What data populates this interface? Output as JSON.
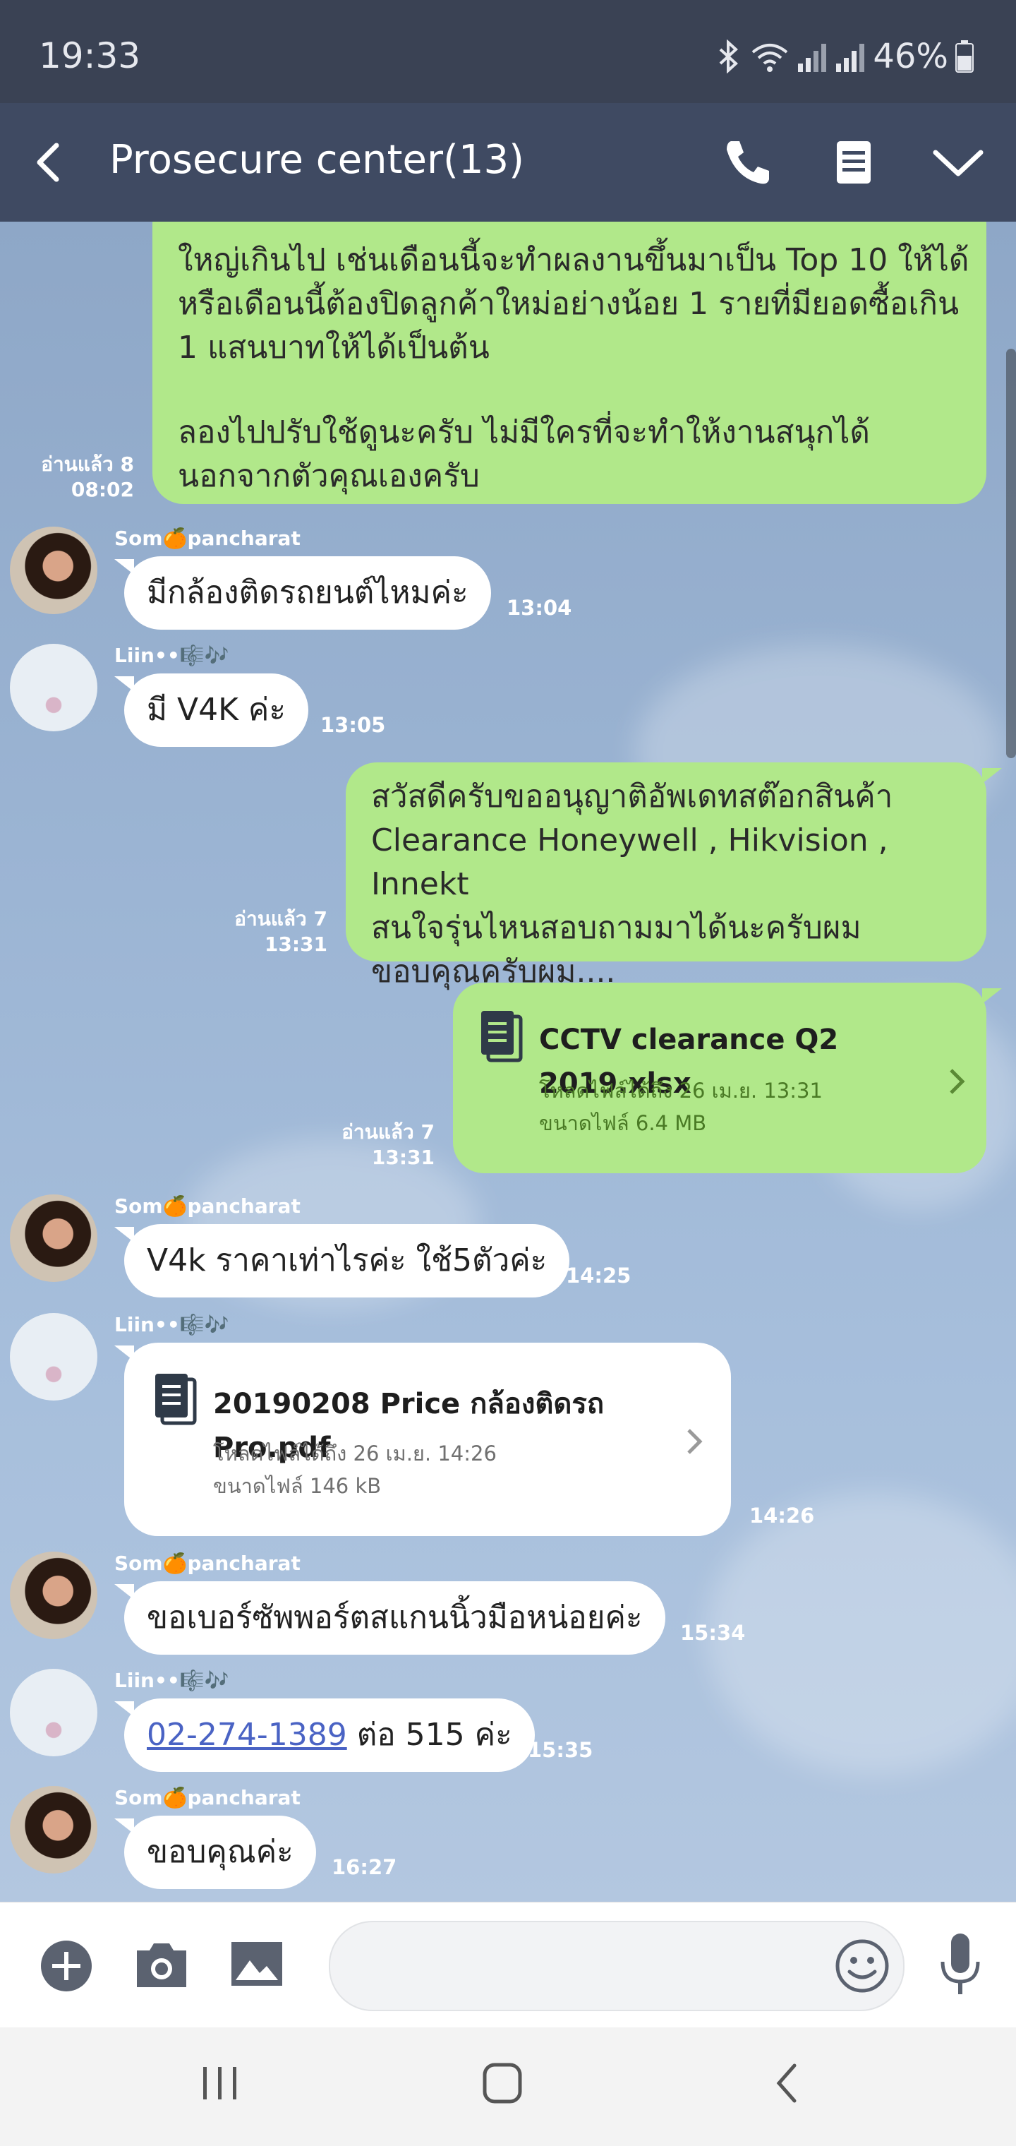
{
  "status_bar": {
    "time": "19:33",
    "battery": "46%"
  },
  "header": {
    "title": "Prosecure center(13)",
    "icons": [
      "back-icon",
      "phone-icon",
      "notes-icon",
      "chevron-down-icon"
    ]
  },
  "messages": {
    "m1": {
      "lines": [
        "ใหญ่เกินไป เช่นเดือนนี้จะทำผลงานขึ้นมาเป็น Top 10 ให้ได้",
        "หรือเดือนนี้ต้องปิดลูกค้าใหม่อย่างน้อย 1 รายที่มียอดซื้อเกิน",
        "1 แสนบาทให้ได้เป็นต้น",
        "ลองไปปรับใช้ดูนะครับ ไม่มีใครที่จะทำให้งานสนุกได้",
        "นอกจากตัวคุณเองครับ"
      ],
      "read": "อ่านแล้ว 8",
      "time": "08:02"
    },
    "m2": {
      "sender": "Som🍊pancharat",
      "text": "มีกล้องติดรถยนต์ไหมค่ะ",
      "time": "13:04"
    },
    "m3": {
      "sender": "Liin••🎼🎶",
      "text": "มี V4K ค่ะ",
      "time": "13:05"
    },
    "m4": {
      "lines": [
        "สวัสดีครับขออนุญาติอัพเดทสต๊อกสินค้า",
        "Clearance Honeywell , Hikvision , Innekt",
        "สนใจรุ่นไหนสอบถามมาได้นะครับผม",
        "ขอบคุณครับผม...."
      ],
      "read": "อ่านแล้ว 7",
      "time": "13:31"
    },
    "m5": {
      "file_name": "CCTV clearance Q2 2019.xlsx",
      "download": "โหลดไฟล์ได้ถึง 26 เม.ย. 13:31",
      "size": "ขนาดไฟล์ 6.4 MB",
      "read": "อ่านแล้ว 7",
      "time": "13:31"
    },
    "m6": {
      "sender": "Som🍊pancharat",
      "text": "V4k ราคาเท่าไรค่ะ ใช้5ตัวค่ะ",
      "time": "14:25"
    },
    "m7": {
      "sender": "Liin••🎼🎶",
      "file_name": "20190208 Price กล้องติดรถ Pro.pdf",
      "download": "โหลดไฟล์ได้ถึง 26 เม.ย. 14:26",
      "size": "ขนาดไฟล์ 146 kB",
      "time": "14:26"
    },
    "m8": {
      "sender": "Som🍊pancharat",
      "text": "ขอเบอร์ซัพพอร์ตสแกนนิ้วมือหน่อยค่ะ",
      "time": "15:34"
    },
    "m9": {
      "sender": "Liin••🎼🎶",
      "phone": "02-274-1389",
      "text": " ต่อ 515 ค่ะ",
      "time": "15:35"
    },
    "m10": {
      "sender": "Som🍊pancharat",
      "text": "ขอบคุณค่ะ",
      "time": "16:27"
    }
  },
  "input_bar": {
    "icons": [
      "plus-icon",
      "camera-icon",
      "image-icon",
      "emoji-icon",
      "microphone-icon"
    ],
    "message_value": ""
  },
  "nav_bar": {
    "icons": [
      "recent-apps-icon",
      "home-icon",
      "back-nav-icon"
    ]
  },
  "colors": {
    "outgoing_bubble": "#b1e88a",
    "incoming_bubble": "#ffffff",
    "header": "#3f4a62",
    "status_bar": "#3a4254"
  }
}
